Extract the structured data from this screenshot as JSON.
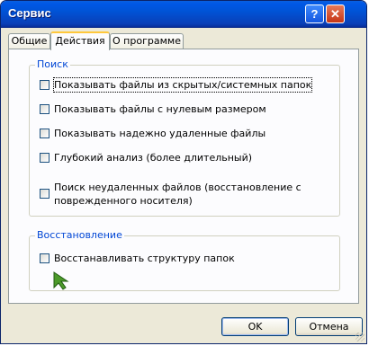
{
  "window": {
    "title": "Сервис",
    "help_glyph": "?",
    "close_glyph": "✕"
  },
  "tabs": [
    {
      "label": "Общие",
      "active": false
    },
    {
      "label": "Действия",
      "active": true
    },
    {
      "label": "О программе",
      "active": false
    }
  ],
  "search_group": {
    "legend": "Поиск",
    "options": [
      {
        "label": "Показывать файлы из скрытых/системных папок",
        "checked": false
      },
      {
        "label": "Показывать файлы с нулевым размером",
        "checked": false
      },
      {
        "label": "Показывать надежно удаленные файлы",
        "checked": false
      },
      {
        "label": "Глубокий анализ (более длительный)",
        "checked": false
      },
      {
        "label_line1": "Поиск неудаленных файлов (восстановление с",
        "label_line2": "поврежденного носителя)",
        "checked": false
      }
    ]
  },
  "restore_group": {
    "legend": "Восстановление",
    "options": [
      {
        "label": "Восстанавливать структуру папок",
        "checked": false
      }
    ]
  },
  "buttons": {
    "ok": "OK",
    "cancel": "Отмена"
  },
  "colors": {
    "titlebar": "#0053d6",
    "legend": "#0046d5",
    "tab_highlight": "#ffc83c",
    "cursor": "#4c9a2a"
  }
}
